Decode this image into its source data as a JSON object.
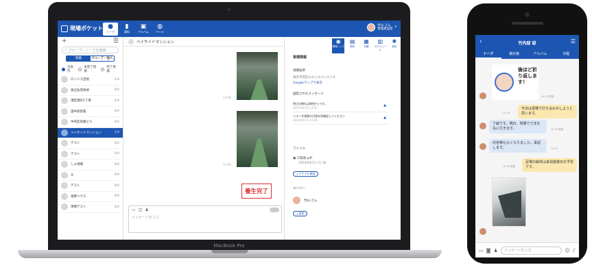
{
  "laptop": {
    "brand_label": "MacBook Pro"
  },
  "app": {
    "logo_text": "現場ポケット",
    "nav": [
      {
        "icon": "chat-icon",
        "label": "トーク"
      },
      {
        "icon": "doc-icon",
        "label": "資料"
      },
      {
        "icon": "photo-icon",
        "label": "アルバム"
      },
      {
        "icon": "globe-icon",
        "label": "ページ"
      }
    ],
    "user": {
      "name": "竹山 さん",
      "sub": "管理者設定"
    }
  },
  "sidebar": {
    "add_glyph": "+",
    "menu_glyph": "☰",
    "search_placeholder": "グループ・トークを検索",
    "seg_tabs": [
      "現場",
      "グループ・個人"
    ],
    "radios": [
      "全表示",
      "未完了現場",
      "完了現場"
    ],
    "rooms": [
      {
        "name": "ロンドス団地",
        "count": "1/4",
        "selected": false
      },
      {
        "name": "渡辺住宅改修",
        "count": "0/4",
        "selected": false
      },
      {
        "name": "港区南町1丁目",
        "count": "2/4",
        "selected": false
      },
      {
        "name": "田中邸新築",
        "count": "0/4",
        "selected": false
      },
      {
        "name": "中央区商業ビル",
        "count": "0/4",
        "selected": false
      },
      {
        "name": "ベイサイドマンション",
        "count": "1/4",
        "selected": true
      },
      {
        "name": "テスト",
        "count": "0/4",
        "selected": false
      },
      {
        "name": "テスト",
        "count": "0/4",
        "selected": false
      },
      {
        "name": "しゅ現場",
        "count": "0/4",
        "selected": false
      },
      {
        "name": "Ｒ",
        "count": "0/4",
        "selected": false
      },
      {
        "name": "テスト",
        "count": "0/4",
        "selected": false
      },
      {
        "name": "星野ハウス",
        "count": "0/4",
        "selected": false
      },
      {
        "name": "現場テスト",
        "count": "0/4",
        "selected": false
      }
    ]
  },
  "chat": {
    "title": "ベイサイドマンション",
    "stamp": "養生完了",
    "times": [
      "12:08",
      "12:09",
      "12:10"
    ],
    "composer_placeholder": "メッセージを入力",
    "send": "送信"
  },
  "detail": {
    "heading": "現場情報",
    "address_label": "現場住所",
    "address": "横浜市西区みなとみらい4-2-8",
    "map_link": "Googleマップで表示",
    "pinned_label": "固定されたメッセージ",
    "pinned": [
      {
        "text": "明日の朝礼は8時からです。",
        "meta": "2024/04/15 13:01"
      },
      {
        "text": "ベランダ清掃の日程を再確認してください",
        "meta": "2024/04/15 13:04"
      }
    ],
    "files_label": "ファイル",
    "file": {
      "name": "工程表.pdf",
      "meta": "2024/04/15 11:38"
    },
    "add_file": "ファイル追加",
    "members_label": "メンバー",
    "member": "竹山 さん",
    "add_member": "追加",
    "tabs": [
      {
        "icon": "info-icon",
        "label": "現場トップ"
      },
      {
        "icon": "doc-icon",
        "label": "資料"
      },
      {
        "icon": "note-icon",
        "label": "日報"
      },
      {
        "icon": "calendar-icon",
        "label": "スケジュール"
      },
      {
        "icon": "gear-icon",
        "label": "設定"
      }
    ]
  },
  "phone": {
    "title": "竹内邸 邸",
    "tabs": [
      "トーク",
      "掲示板",
      "アルバム",
      "日程"
    ],
    "sticker_text": "後ほど折り返します！",
    "bubbles": [
      {
        "text": "今日は現場で打ち合わせしようと思います。",
        "side": "out"
      },
      {
        "text": "了解です。明日、現場で寸法を先に行きます。",
        "side": "in"
      },
      {
        "text": "内容等もなくなりました。承認します。",
        "side": "in"
      },
      {
        "text": "足場の解体は来週金曜日の予定です。",
        "side": "out"
      }
    ],
    "times": [
      "14:22 既読",
      "14:26",
      "14:30 既読",
      "14:32",
      "14:36 既読"
    ],
    "input_placeholder": "メッセージを入力"
  }
}
